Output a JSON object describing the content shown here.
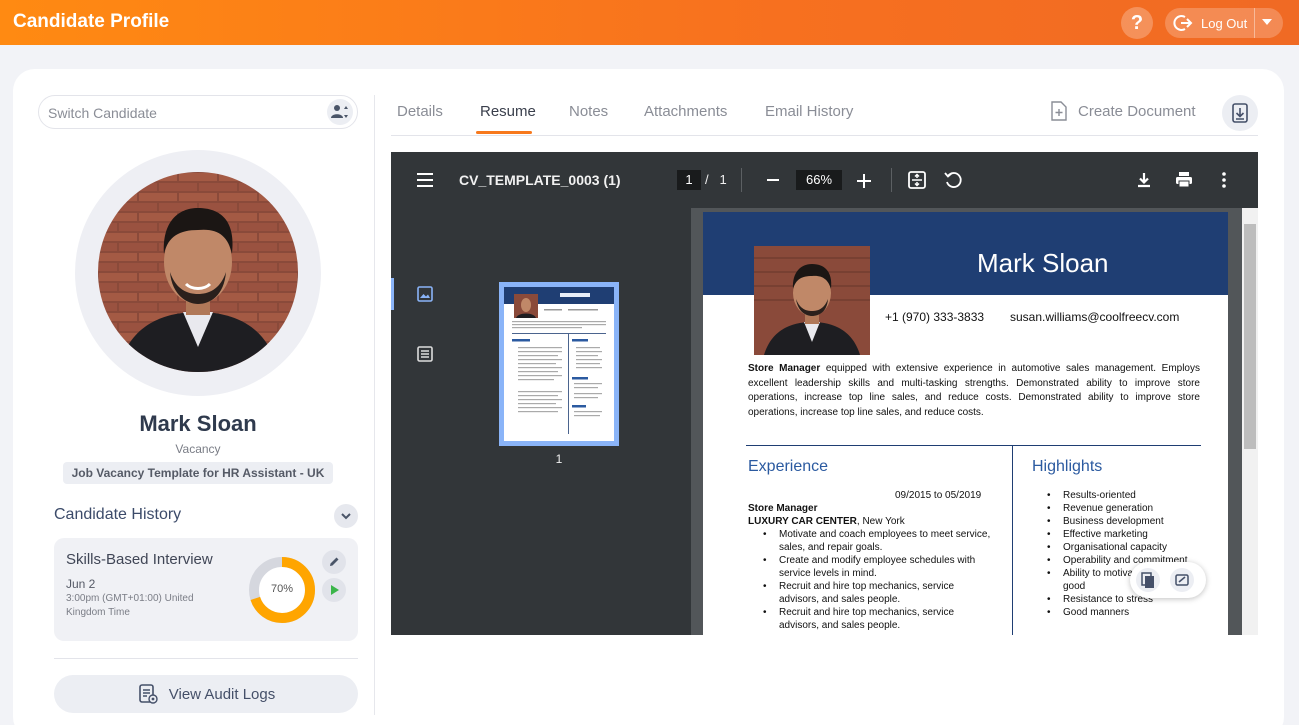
{
  "app": {
    "title": "Candidate Profile"
  },
  "header": {
    "help_label": "?",
    "logout_label": "Log Out"
  },
  "sidebar": {
    "switch_placeholder": "Switch Candidate",
    "candidate_name": "Mark Sloan",
    "vacancy_label": "Vacancy",
    "vacancy_name": "Job Vacancy Template for HR Assistant - UK",
    "history_title": "Candidate History",
    "history": {
      "title": "Skills-Based Interview",
      "date": "Jun 2",
      "time": "3:00pm (GMT+01:00) United Kingdom Time",
      "progress_label": "70%",
      "progress": 0.7
    },
    "audit_label": "View Audit Logs"
  },
  "tabs": [
    {
      "label": "Details"
    },
    {
      "label": "Resume"
    },
    {
      "label": "Notes"
    },
    {
      "label": "Attachments"
    },
    {
      "label": "Email History"
    }
  ],
  "active_tab": "Resume",
  "create_document_label": "Create Document",
  "viewer": {
    "file_name": "CV_TEMPLATE_0003 (1)",
    "current_page": "1",
    "page_sep": "/",
    "total_pages": "1",
    "zoom": "66%",
    "thumb_page_number": "1"
  },
  "resume": {
    "name": "Mark Sloan",
    "phone": "+1 (970) 333-3833",
    "email": "susan.williams@coolfreecv.com",
    "summary_lead": "Store Manager",
    "summary_rest": " equipped with extensive experience in automotive sales management. Employs excellent leadership skills and multi-tasking strengths. Demonstrated ability to improve store operations, increase top line sales, and reduce costs.  Demonstrated ability to improve store operations, increase top line sales, and reduce costs.",
    "experience_heading": "Experience",
    "highlights_heading": "Highlights",
    "job_dates": "09/2015 to 05/2019",
    "job_role": "Store Manager",
    "job_company": "LUXURY CAR CENTER",
    "job_location": ", New York",
    "job_bullets": [
      "Motivate and coach employees to meet service, sales, and repair goals.",
      "Create and modify employee schedules with service levels in mind.",
      "Recruit and hire top mechanics, service advisors, and sales people.",
      "Recruit and hire top mechanics, service advisors, and sales people."
    ],
    "highlights": [
      "Results-oriented",
      "Revenue generation",
      "Business development",
      "Effective marketing",
      "Organisational capacity",
      "Operability and commitment",
      "Ability to motivate and maintain good",
      "Resistance to stress",
      "Good manners"
    ]
  },
  "colors": {
    "accent": "#f7791d",
    "resume_banner": "#1f3e73",
    "resume_heading": "#2b5aa0",
    "progress_ring": "#ffa500"
  }
}
